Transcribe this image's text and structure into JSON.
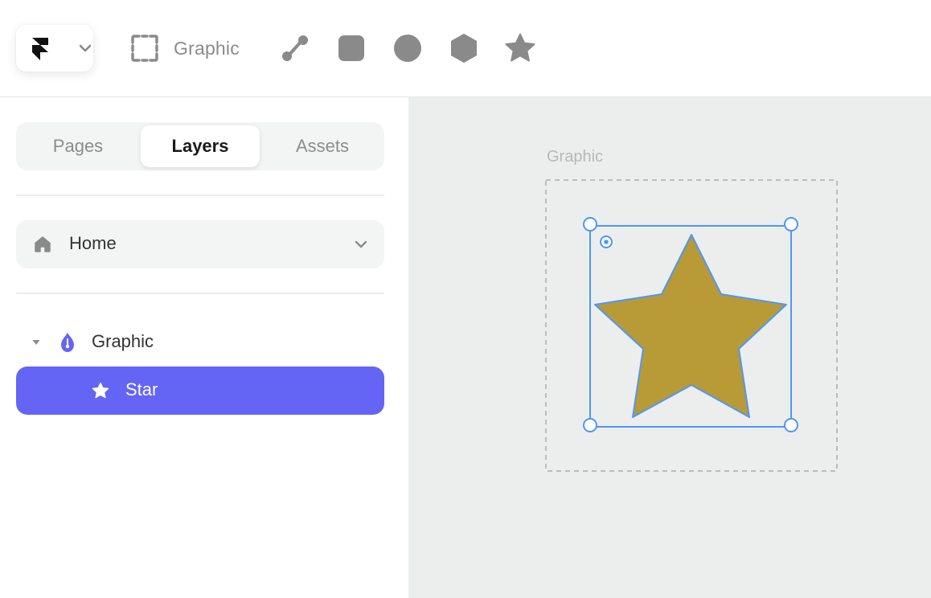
{
  "toolbar": {
    "graphic_label": "Graphic",
    "icons": [
      "framer-logo-icon",
      "chevron-down-icon",
      "frame-icon",
      "path-icon",
      "rectangle-icon",
      "circle-icon",
      "polygon-icon",
      "star-icon"
    ]
  },
  "sidebar": {
    "tabs": {
      "pages": "Pages",
      "layers": "Layers",
      "assets": "Assets",
      "active": "Layers"
    },
    "page_select": {
      "value": "Home"
    },
    "layers": [
      {
        "label": "Graphic",
        "icon": "pen-nib-icon",
        "expanded": true
      },
      {
        "label": "Star",
        "icon": "star-icon",
        "selected": true
      }
    ]
  },
  "canvas": {
    "frame_label": "Graphic"
  },
  "colors": {
    "accent": "#6464f5",
    "selection": "#4f97f5",
    "star_fill": "#b89a37",
    "canvas_bg": "#eceeee"
  }
}
